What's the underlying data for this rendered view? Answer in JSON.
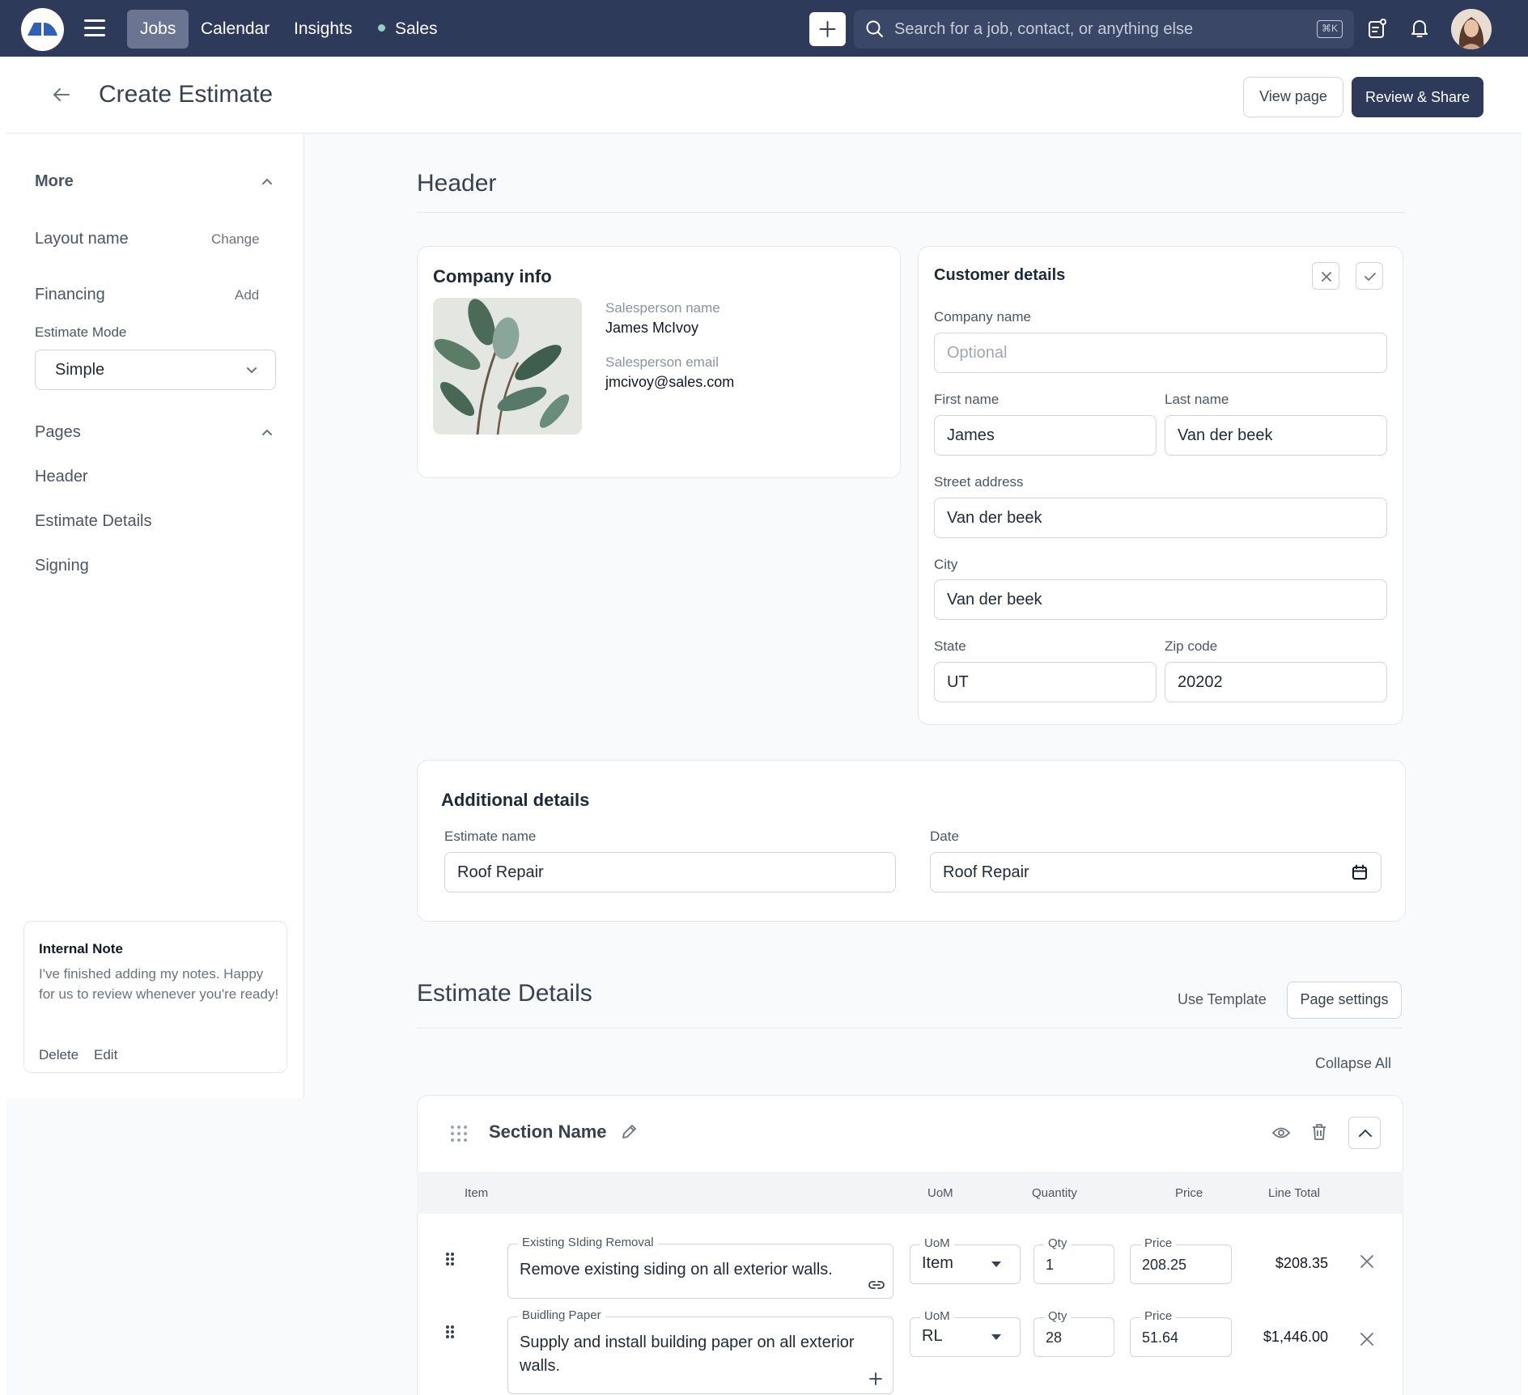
{
  "nav": {
    "tabs": [
      "Jobs",
      "Calendar",
      "Insights",
      "Sales"
    ],
    "search_placeholder": "Search for a job, contact, or anything else",
    "shortcut": "⌘K"
  },
  "page": {
    "title": "Create Estimate",
    "view_page": "View page",
    "review_share": "Review & Share"
  },
  "sidebar": {
    "more": "More",
    "layout_name": "Layout name",
    "change": "Change",
    "financing": "Financing",
    "add": "Add",
    "estimate_mode_label": "Estimate Mode",
    "estimate_mode_value": "Simple",
    "pages_label": "Pages",
    "pages": [
      "Header",
      "Estimate Details",
      "Signing"
    ],
    "note": {
      "title": "Internal Note",
      "body": "I've finished adding my notes. Happy for us to review whenever you're ready!",
      "delete": "Delete",
      "edit": "Edit"
    }
  },
  "header_section": {
    "title": "Header",
    "company_info": {
      "title": "Company info",
      "salesperson_name_label": "Salesperson name",
      "salesperson_name": "James McIvoy",
      "salesperson_email_label": "Salesperson email",
      "salesperson_email": "jmcivoy@sales.com"
    },
    "customer": {
      "title": "Customer details",
      "company_name_label": "Company name",
      "company_name_placeholder": "Optional",
      "first_name_label": "First name",
      "first_name": "James",
      "last_name_label": "Last name",
      "last_name": "Van der beek",
      "street_label": "Street address",
      "street": "Van der beek",
      "city_label": "City",
      "city": "Van der beek",
      "state_label": "State",
      "state": "UT",
      "zip_label": "Zip code",
      "zip": "20202"
    },
    "additional": {
      "title": "Additional details",
      "estimate_name_label": "Estimate name",
      "estimate_name": "Roof Repair",
      "date_label": "Date",
      "date": "Roof Repair"
    }
  },
  "estimate_details": {
    "title": "Estimate Details",
    "use_template": "Use Template",
    "page_settings": "Page settings",
    "collapse_all": "Collapse All",
    "section_name": "Section Name",
    "columns": [
      "Item",
      "UoM",
      "Quantity",
      "Price",
      "Line Total"
    ],
    "field_labels": {
      "uom": "UoM",
      "qty": "Qty",
      "price": "Price"
    },
    "rows": [
      {
        "name": "Existing SIding Removal",
        "description": "Remove existing siding on all exterior walls.",
        "uom": "Item",
        "qty": "1",
        "price": "208.25",
        "total": "$208.35"
      },
      {
        "name": "Buidling Paper",
        "description": "Supply and install building paper on all exterior walls.",
        "uom": "RL",
        "qty": "28",
        "price": "51.64",
        "total": "$1,446.00"
      }
    ]
  },
  "colors": {
    "nav": "#2e3a5a",
    "accent": "#2e3a5a",
    "status_dot": "#8fd3c4"
  }
}
